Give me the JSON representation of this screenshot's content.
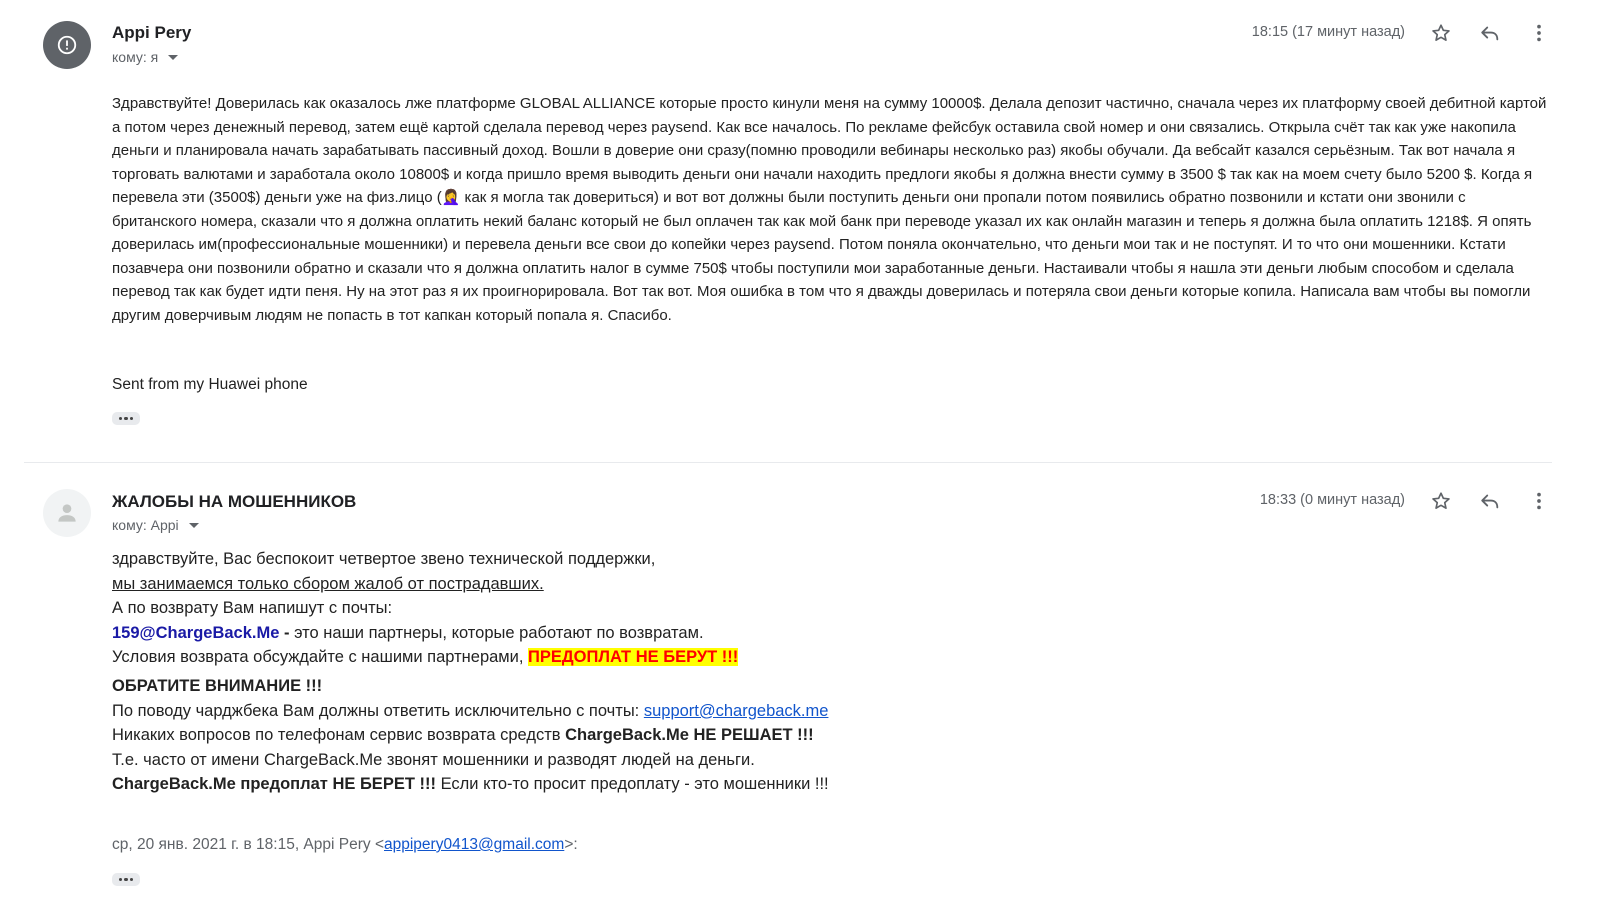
{
  "message1": {
    "sender": "Appi Pery",
    "to_label": "кому: я",
    "time": "18:15 (17 минут назад)",
    "paragraph": "Здравствуйте! Доверилась как оказалось лже платформе GLOBAL ALLIANCE которые просто кинули меня на сумму 10000$. Делала депозит частично, сначала через их платформу своей дебитной картой а потом через денежный перевод, затем ещё картой сделала перевод через paysend. Как все началось. По рекламе фейсбук оставила свой номер и они связались. Открыла счёт так как уже накопила деньги и планировала начать зарабатывать пассивный доход. Вошли в доверие они сразу(помню проводили вебинары несколько раз) якобы обучали. Да вебсайт казался серьёзным. Так вот начала я торговать валютами и заработала около 10800$ и когда пришло время выводить деньги они начали находить предлоги якобы я должна внести сумму в 3500 $ так как на моем счету было 5200 $. Когда я перевела эти (3500$) деньги уже на физ.лицо (🤦‍♀️ как я могла так довериться) и вот вот должны были поступить деньги они пропали потом появились обратно позвонили и кстати они звонили с британского номера, сказали что я должна оплатить некий баланс который не был оплачен так как мой банк при переводе указал их как онлайн магазин и теперь я должна была оплатить 1218$. Я опять доверилась им(профессиональные мошенники) и перевела деньги все свои до копейки через  paysend. Потом поняла окончательно, что деньги мои так и не поступят. И то что они мошенники. Кстати позавчера они позвонили обратно и сказали что я должна оплатить налог в сумме 750$ чтобы поступили мои заработанные деньги. Настаивали чтобы я нашла эти деньги любым способом и сделала перевод так как будет идти пеня. Ну на этот раз я их проигнорировала. Вот так вот. Моя ошибка в том что я дважды доверилась и потеряла свои деньги которые копила. Написала вам чтобы вы помогли другим доверчивым людям не попасть в тот капкан который попала я. Спасибо.",
    "signature": "Sent from my Huawei phone"
  },
  "message2": {
    "sender": "ЖАЛОБЫ НА МОШЕННИКОВ",
    "to_label": "кому: Appi",
    "time": "18:33 (0 минут назад)",
    "line1": "здравствуйте, Вас беспокоит четвертое звено технической поддержки,",
    "line2": "мы занимаемся только сбором жалоб от пострадавших.",
    "line3": "А по возврату Вам напишут с почты:",
    "line4_email": "159@ChargeBack.Me",
    "line4_dash": " - ",
    "line4_rest": "это наши партнеры, которые работают по возвратам.",
    "line5_text": "Условия возврата обсуждайте с нашими партнерами, ",
    "line5_highlight": "ПРЕДОПЛАТ НЕ БЕРУТ !!!",
    "line6": "ОБРАТИТЕ ВНИМАНИЕ !!!",
    "line7_text": "По поводу чарджбека Вам должны ответить исключительно с почты: ",
    "line7_link": "support@chargeback.me",
    "line8_text": "Никаких вопросов по телефонам сервис возврата средств ",
    "line8_bold": "ChargeBack.Me НЕ РЕШАЕТ !!!",
    "line9": "Т.е. часто от имени ChargeBack.Me звонят мошенники и разводят людей на деньги.",
    "line10_bold": "ChargeBack.Me предоплат НЕ БЕРЕТ !!!",
    "line10_text": " Если кто-то просит предоплату - это мошенники !!!",
    "quote_prefix": "ср, 20 янв. 2021 г. в 18:15, Appi Pery <",
    "quote_email": "appipery0413@gmail.com",
    "quote_suffix": ">:"
  },
  "icons": {
    "star": "star-icon",
    "reply": "reply-icon",
    "more": "more-vert-icon",
    "alert": "alert-circle-icon",
    "person": "person-icon"
  },
  "colors": {
    "highlight_bg": "#ffff00",
    "highlight_text": "#ff0000",
    "link": "#1155cc",
    "partner_email": "#1a1aa6"
  }
}
